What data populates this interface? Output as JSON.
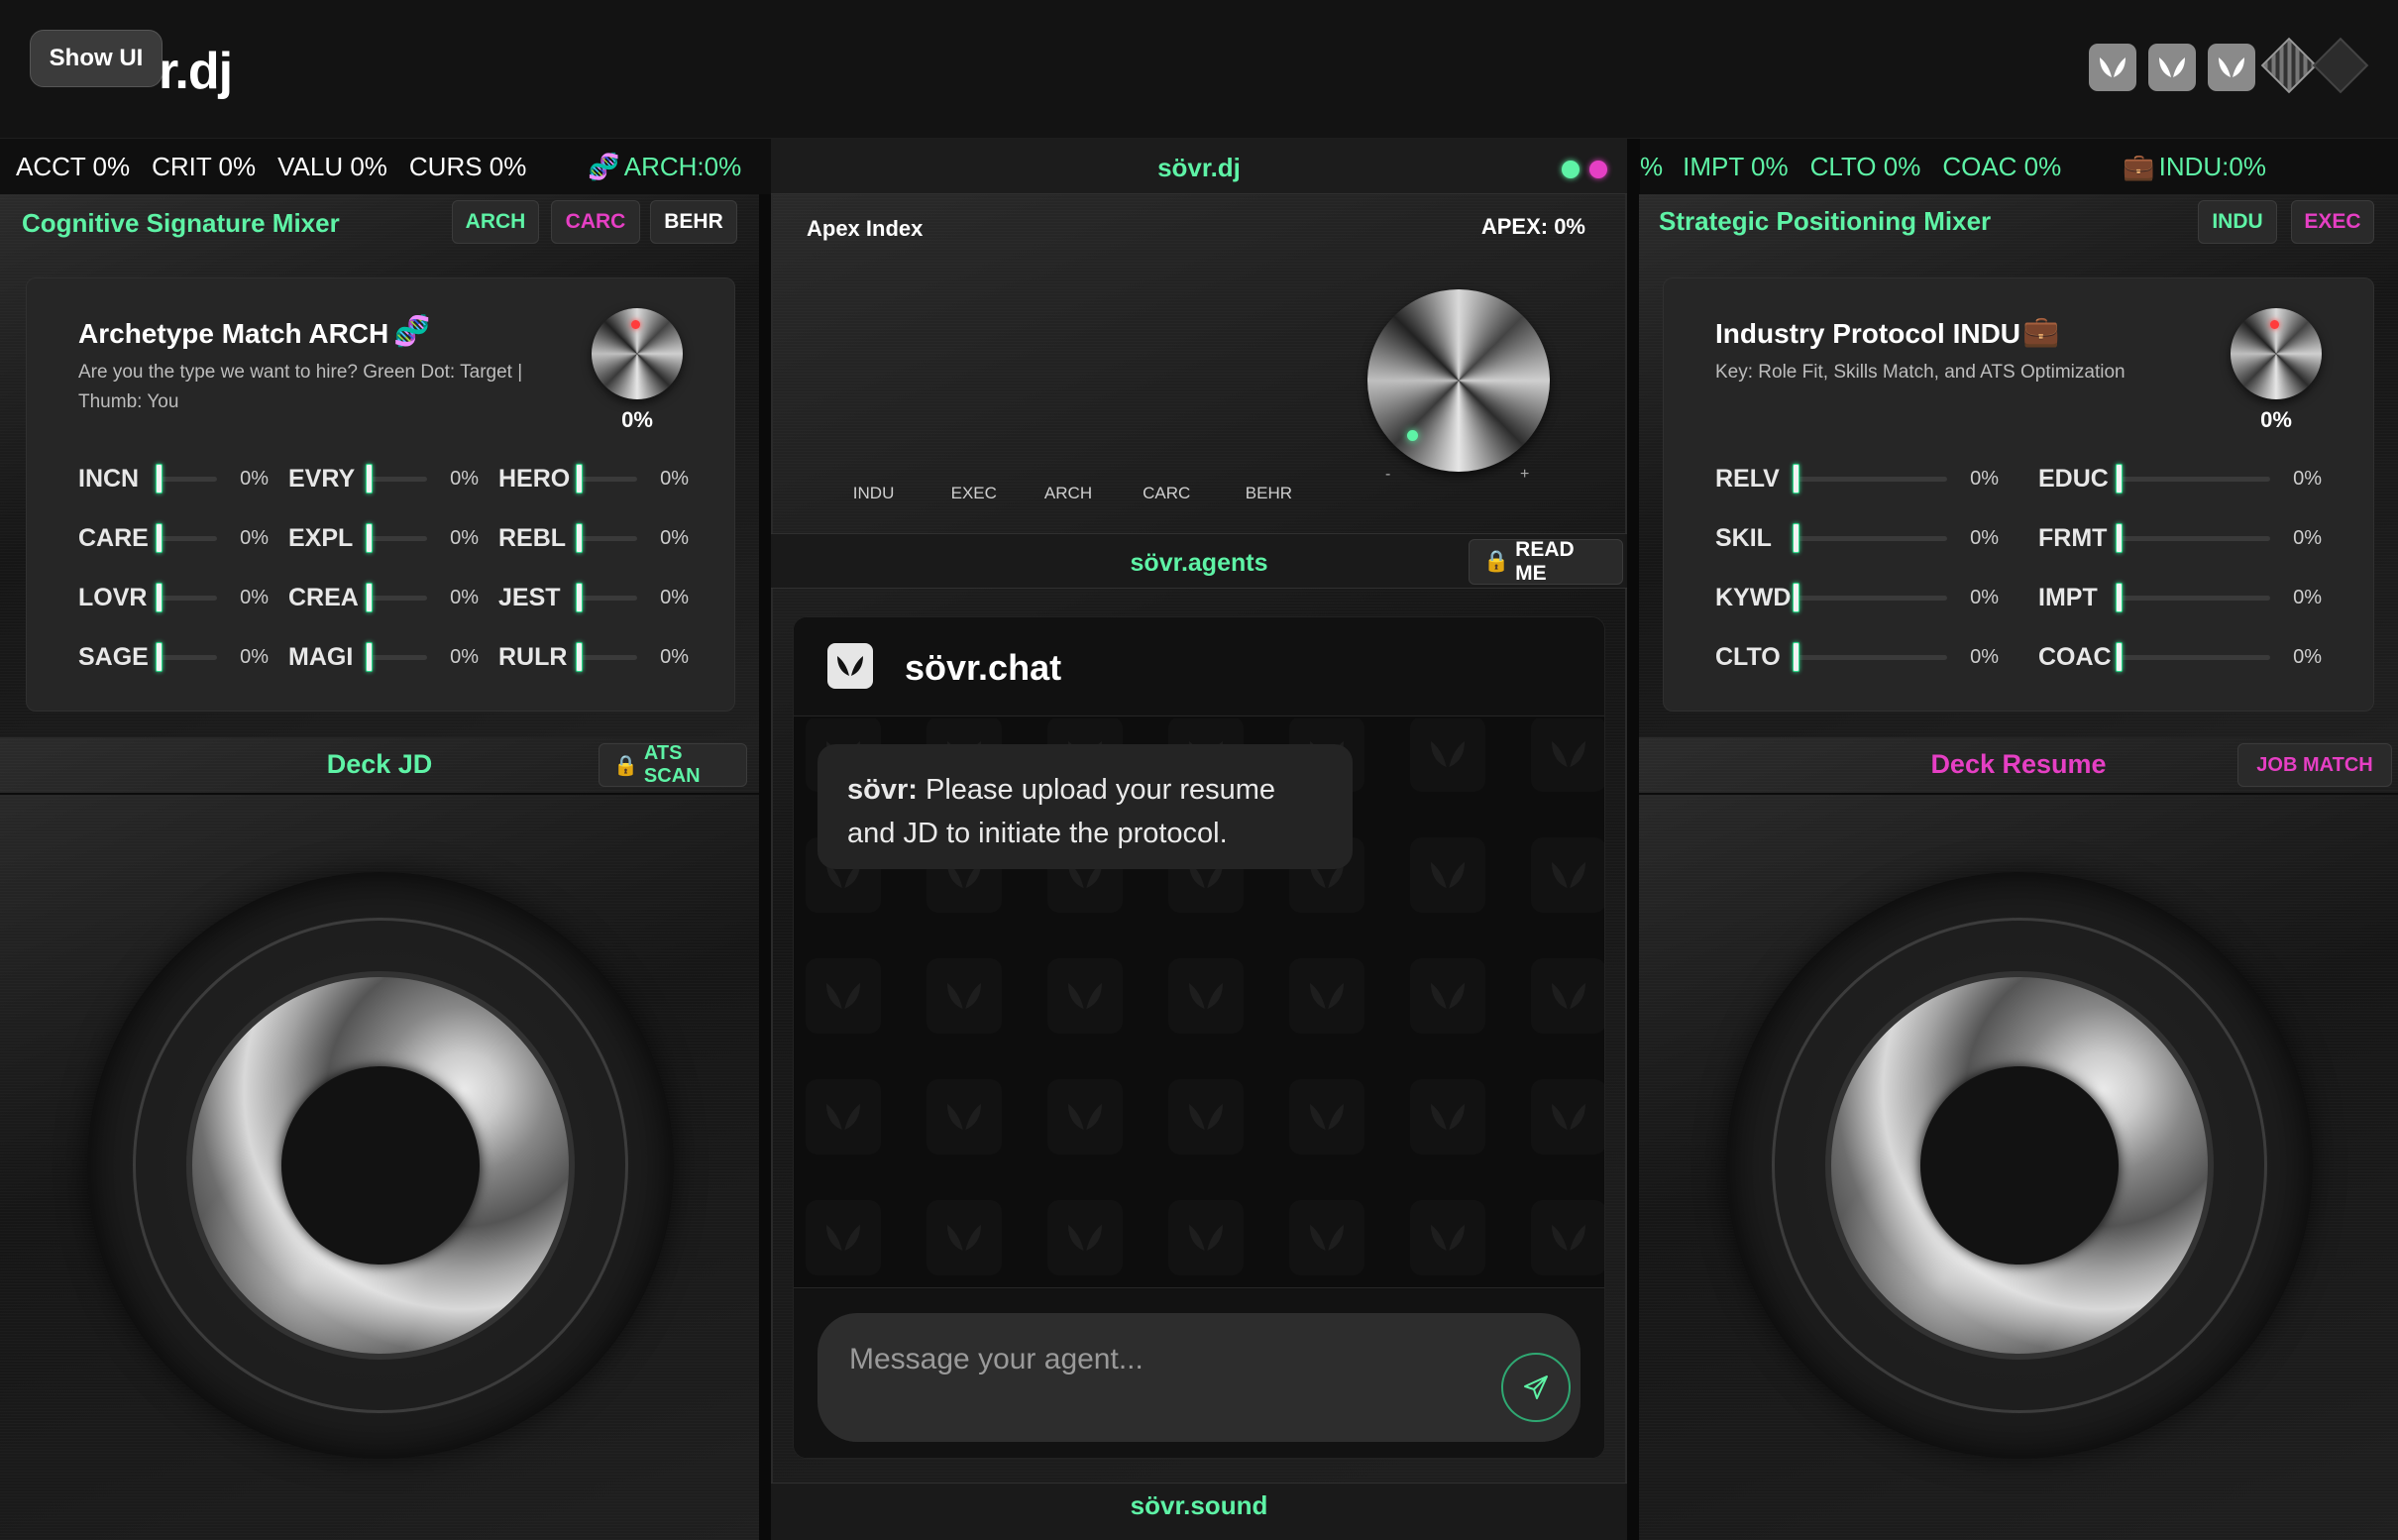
{
  "app": {
    "logo": "r.dj",
    "show_ui": "Show UI"
  },
  "ticker_left": [
    {
      "label": "ACCT 0%",
      "accent": false
    },
    {
      "label": "CRIT 0%",
      "accent": false
    },
    {
      "label": "VALU 0%",
      "accent": false
    },
    {
      "label": "CURS 0%",
      "accent": false
    },
    {
      "label": "ARCH:0%",
      "accent": true
    }
  ],
  "ticker_right": [
    {
      "label": "%",
      "accent": true
    },
    {
      "label": "IMPT 0%",
      "accent": true
    },
    {
      "label": "CLTO 0%",
      "accent": true
    },
    {
      "label": "COAC 0%",
      "accent": true
    },
    {
      "label": "INDU:0%",
      "accent": true
    }
  ],
  "left_mixer": {
    "title": "Cognitive Signature Mixer",
    "buttons": [
      "ARCH",
      "CARC",
      "BEHR"
    ],
    "card": {
      "title": "Archetype Match ARCH",
      "subtitle": "Are you the type we want to hire? Green Dot: Target | Thumb: You",
      "knob_value": "0%",
      "sliders": [
        {
          "label": "INCN",
          "value": "0%"
        },
        {
          "label": "EVRY",
          "value": "0%"
        },
        {
          "label": "HERO",
          "value": "0%"
        },
        {
          "label": "CARE",
          "value": "0%"
        },
        {
          "label": "EXPL",
          "value": "0%"
        },
        {
          "label": "REBL",
          "value": "0%"
        },
        {
          "label": "LOVR",
          "value": "0%"
        },
        {
          "label": "CREA",
          "value": "0%"
        },
        {
          "label": "JEST",
          "value": "0%"
        },
        {
          "label": "SAGE",
          "value": "0%"
        },
        {
          "label": "MAGI",
          "value": "0%"
        },
        {
          "label": "RULR",
          "value": "0%"
        }
      ]
    }
  },
  "center": {
    "header_title": "sövr.dj",
    "apex_label": "Apex Index",
    "apex_value": "APEX: 0%",
    "apex_axis": [
      "INDU",
      "EXEC",
      "ARCH",
      "CARC",
      "BEHR"
    ],
    "knob_minus": "-",
    "knob_plus": "+",
    "agents_title": "sövr.agents",
    "read_me": "READ ME",
    "chat_title": "sövr.chat",
    "message_sender": "sövr:",
    "message_text": "Please upload your resume and JD to initiate the protocol.",
    "input_placeholder": "Message your agent...",
    "footer_title": "sövr.sound"
  },
  "right_mixer": {
    "title": "Strategic Positioning Mixer",
    "buttons": [
      "INDU",
      "EXEC"
    ],
    "card": {
      "title": "Industry Protocol INDU",
      "subtitle": "Key: Role Fit, Skills Match, and ATS Optimization",
      "knob_value": "0%",
      "sliders": [
        {
          "label": "RELV",
          "value": "0%"
        },
        {
          "label": "EDUC",
          "value": "0%"
        },
        {
          "label": "SKIL",
          "value": "0%"
        },
        {
          "label": "FRMT",
          "value": "0%"
        },
        {
          "label": "KYWD",
          "value": "0%"
        },
        {
          "label": "IMPT",
          "value": "0%"
        },
        {
          "label": "CLTO",
          "value": "0%"
        },
        {
          "label": "COAC",
          "value": "0%"
        }
      ]
    }
  },
  "deck_left": {
    "title": "Deck JD",
    "button": "ATS SCAN"
  },
  "deck_right": {
    "title": "Deck Resume",
    "button": "JOB MATCH"
  },
  "colors": {
    "accent_green": "#5ef3a6",
    "accent_pink": "#e63fc4"
  },
  "icons": [
    "sovr-leaf-icon",
    "diamond-icon",
    "lock-icon",
    "send-icon",
    "dna-icon",
    "briefcase-icon"
  ]
}
